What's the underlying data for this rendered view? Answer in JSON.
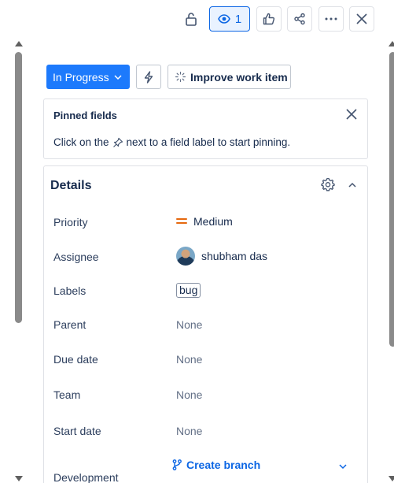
{
  "toolbar": {
    "watch_count": "1",
    "icons": [
      "lock-icon",
      "eye-icon",
      "thumbs-up-icon",
      "share-icon",
      "more-icon",
      "close-icon"
    ]
  },
  "actions": {
    "status_label": "In Progress",
    "improve_label": "Improve work item"
  },
  "pinned": {
    "title": "Pinned fields",
    "hint_before": "Click on the",
    "hint_after": "next to a field label to start pinning."
  },
  "details": {
    "title": "Details",
    "fields": [
      {
        "label": "Priority",
        "value": "Medium"
      },
      {
        "label": "Assignee",
        "value": "shubham das"
      },
      {
        "label": "Labels",
        "value": "bug"
      },
      {
        "label": "Parent",
        "value": "None"
      },
      {
        "label": "Due date",
        "value": "None"
      },
      {
        "label": "Team",
        "value": "None"
      },
      {
        "label": "Start date",
        "value": "None"
      },
      {
        "label": "Development",
        "value": "Create branch"
      }
    ]
  },
  "colors": {
    "accent": "#1d7afc",
    "link": "#0c66e4",
    "priority_medium": "#e56910",
    "border": "#dfe1e6"
  }
}
